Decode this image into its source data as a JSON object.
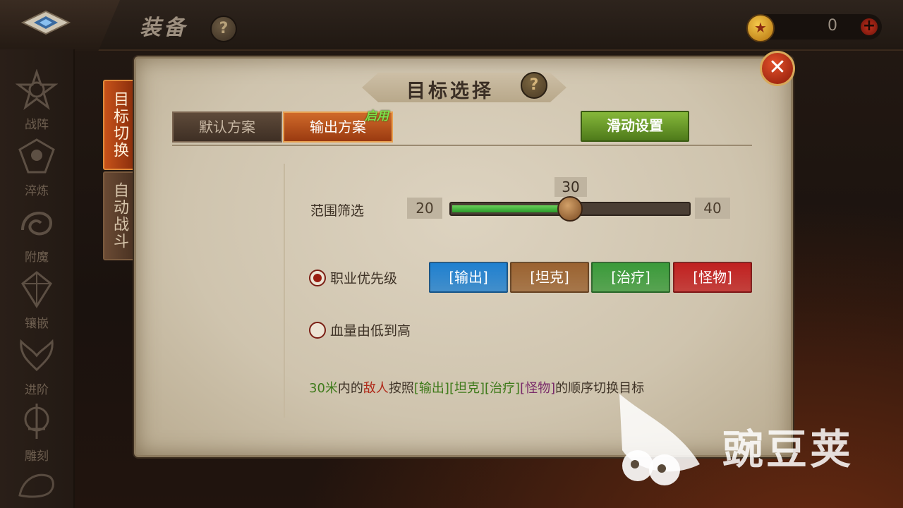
{
  "topbar": {
    "title": "装备",
    "help": "?",
    "currency_value": "0",
    "add": "+"
  },
  "nav": {
    "items": [
      {
        "label": "战阵",
        "icon": "star-emblem-icon"
      },
      {
        "label": "淬炼",
        "icon": "forge-emblem-icon"
      },
      {
        "label": "附魔",
        "icon": "dragon-emblem-icon"
      },
      {
        "label": "镶嵌",
        "icon": "gem-emblem-icon"
      },
      {
        "label": "进阶",
        "icon": "wing-emblem-icon"
      },
      {
        "label": "雕刻",
        "icon": "sword-emblem-icon"
      }
    ]
  },
  "side_tabs": {
    "active": "目标切换",
    "inactive": "自动战斗"
  },
  "panel": {
    "title": "目标选择",
    "help": "?",
    "close": "✕",
    "tabs": [
      {
        "label": "默认方案"
      },
      {
        "label": "输出方案"
      }
    ],
    "enabled_tag": "启用",
    "slide_settings": "滑动设置",
    "range": {
      "label": "范围筛选",
      "min": 20,
      "max": 40,
      "value": 30
    },
    "options": [
      {
        "label": "职业优先级",
        "checked": true
      },
      {
        "label": "血量由低到高",
        "checked": false
      }
    ],
    "priority": [
      {
        "label": "[输出]",
        "color": "#1e7fcf"
      },
      {
        "label": "[坦克]",
        "color": "#9a6230"
      },
      {
        "label": "[治疗]",
        "color": "#3a9a3a"
      },
      {
        "label": "[怪物]",
        "color": "#c02020"
      }
    ],
    "description": {
      "dist": "30米",
      "t1": "内的",
      "enemy": "敌人",
      "t2": "按照",
      "p1": "[输出]",
      "p2": "[坦克]",
      "p3": "[治疗]",
      "p4": "[怪物]",
      "t3": "的顺序切换目标"
    }
  },
  "watermark": {
    "text": "豌豆荚"
  }
}
